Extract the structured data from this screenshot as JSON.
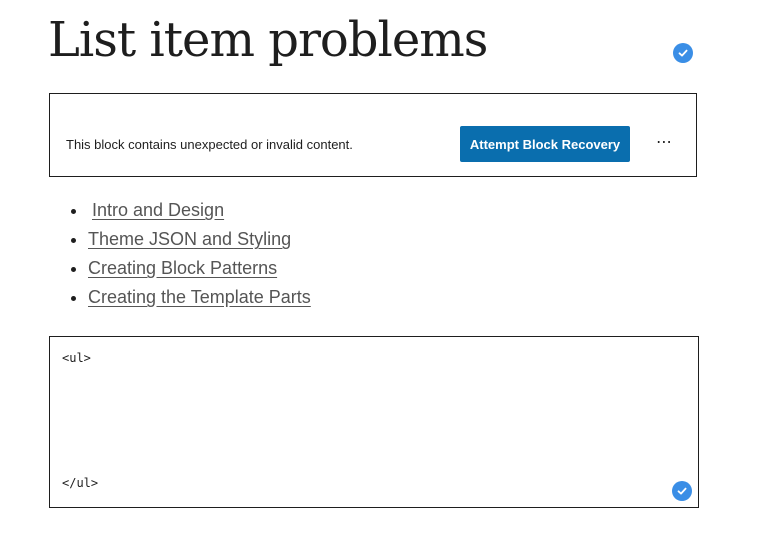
{
  "post": {
    "title": "List item problems"
  },
  "warning_block": {
    "message": "This block contains unexpected or invalid content.",
    "recovery_label": "Attempt Block Recovery",
    "more_label": "⋯"
  },
  "list": {
    "items": [
      {
        "label": "Intro and Design"
      },
      {
        "label": "Theme JSON and Styling"
      },
      {
        "label": "Creating Block Patterns"
      },
      {
        "label": "Creating the Template Parts"
      }
    ]
  },
  "html_block": {
    "open_tag": "<ul>",
    "close_tag": "</ul>"
  },
  "colors": {
    "accent": "#0a6eae",
    "check_badge": "#3a8ee6",
    "text": "#1e1e1e",
    "link": "#555555"
  },
  "icons": {
    "status": "check-circle-icon",
    "options": "ellipsis-icon"
  }
}
